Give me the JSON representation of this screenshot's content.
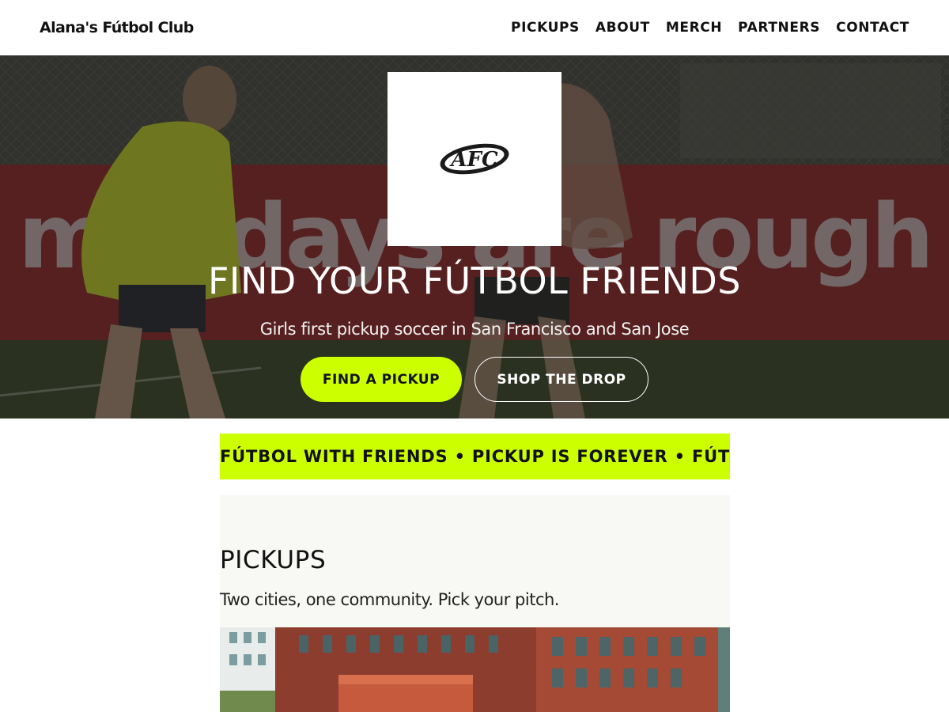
{
  "header": {
    "brand": "Alana's Fútbol Club",
    "nav": [
      "PICKUPS",
      "ABOUT",
      "MERCH",
      "PARTNERS",
      "CONTACT"
    ]
  },
  "hero": {
    "background_sign_text": "mondays are rough",
    "logo_text": "AFC",
    "title": "FIND YOUR FÚTBOL FRIENDS",
    "subtitle": "Girls first pickup soccer in San Francisco and San Jose",
    "primary_button": "FIND A PICKUP",
    "secondary_button": "SHOP THE DROP"
  },
  "ticker": {
    "text": "FÚTBOL WITH FRIENDS • PICKUP IS FOREVER • FÚTBOL WITH FRIENDS • PICKUP IS FOREVER"
  },
  "pickups": {
    "heading": "PICKUPS",
    "tagline": "Two cities, one community. Pick your pitch."
  },
  "colors": {
    "accent": "#ccff00",
    "text": "#111111",
    "section_bg": "#f8f8f5"
  }
}
